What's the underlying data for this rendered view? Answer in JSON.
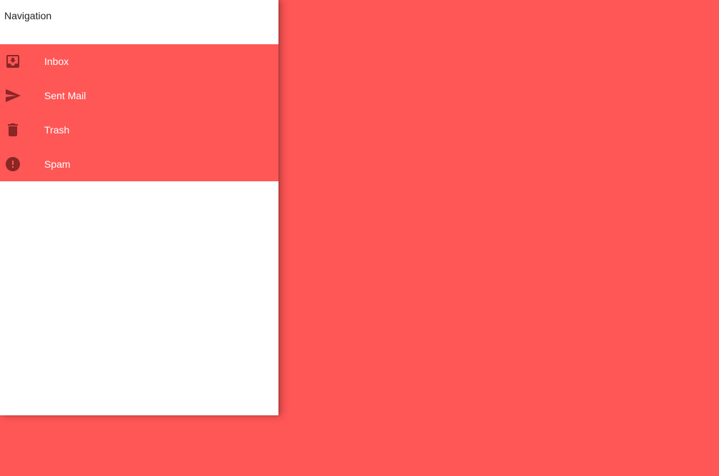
{
  "drawer": {
    "title": "Navigation"
  },
  "nav": {
    "items": [
      {
        "label": "Inbox",
        "icon": "inbox-icon"
      },
      {
        "label": "Sent Mail",
        "icon": "send-icon"
      },
      {
        "label": "Trash",
        "icon": "trash-icon"
      },
      {
        "label": "Spam",
        "icon": "report-icon"
      }
    ]
  },
  "colors": {
    "accent": "#ff5656",
    "icon": "#8a2626",
    "drawer_bg": "#ffffff",
    "title_text": "#222222",
    "label_text": "#ffffff"
  }
}
